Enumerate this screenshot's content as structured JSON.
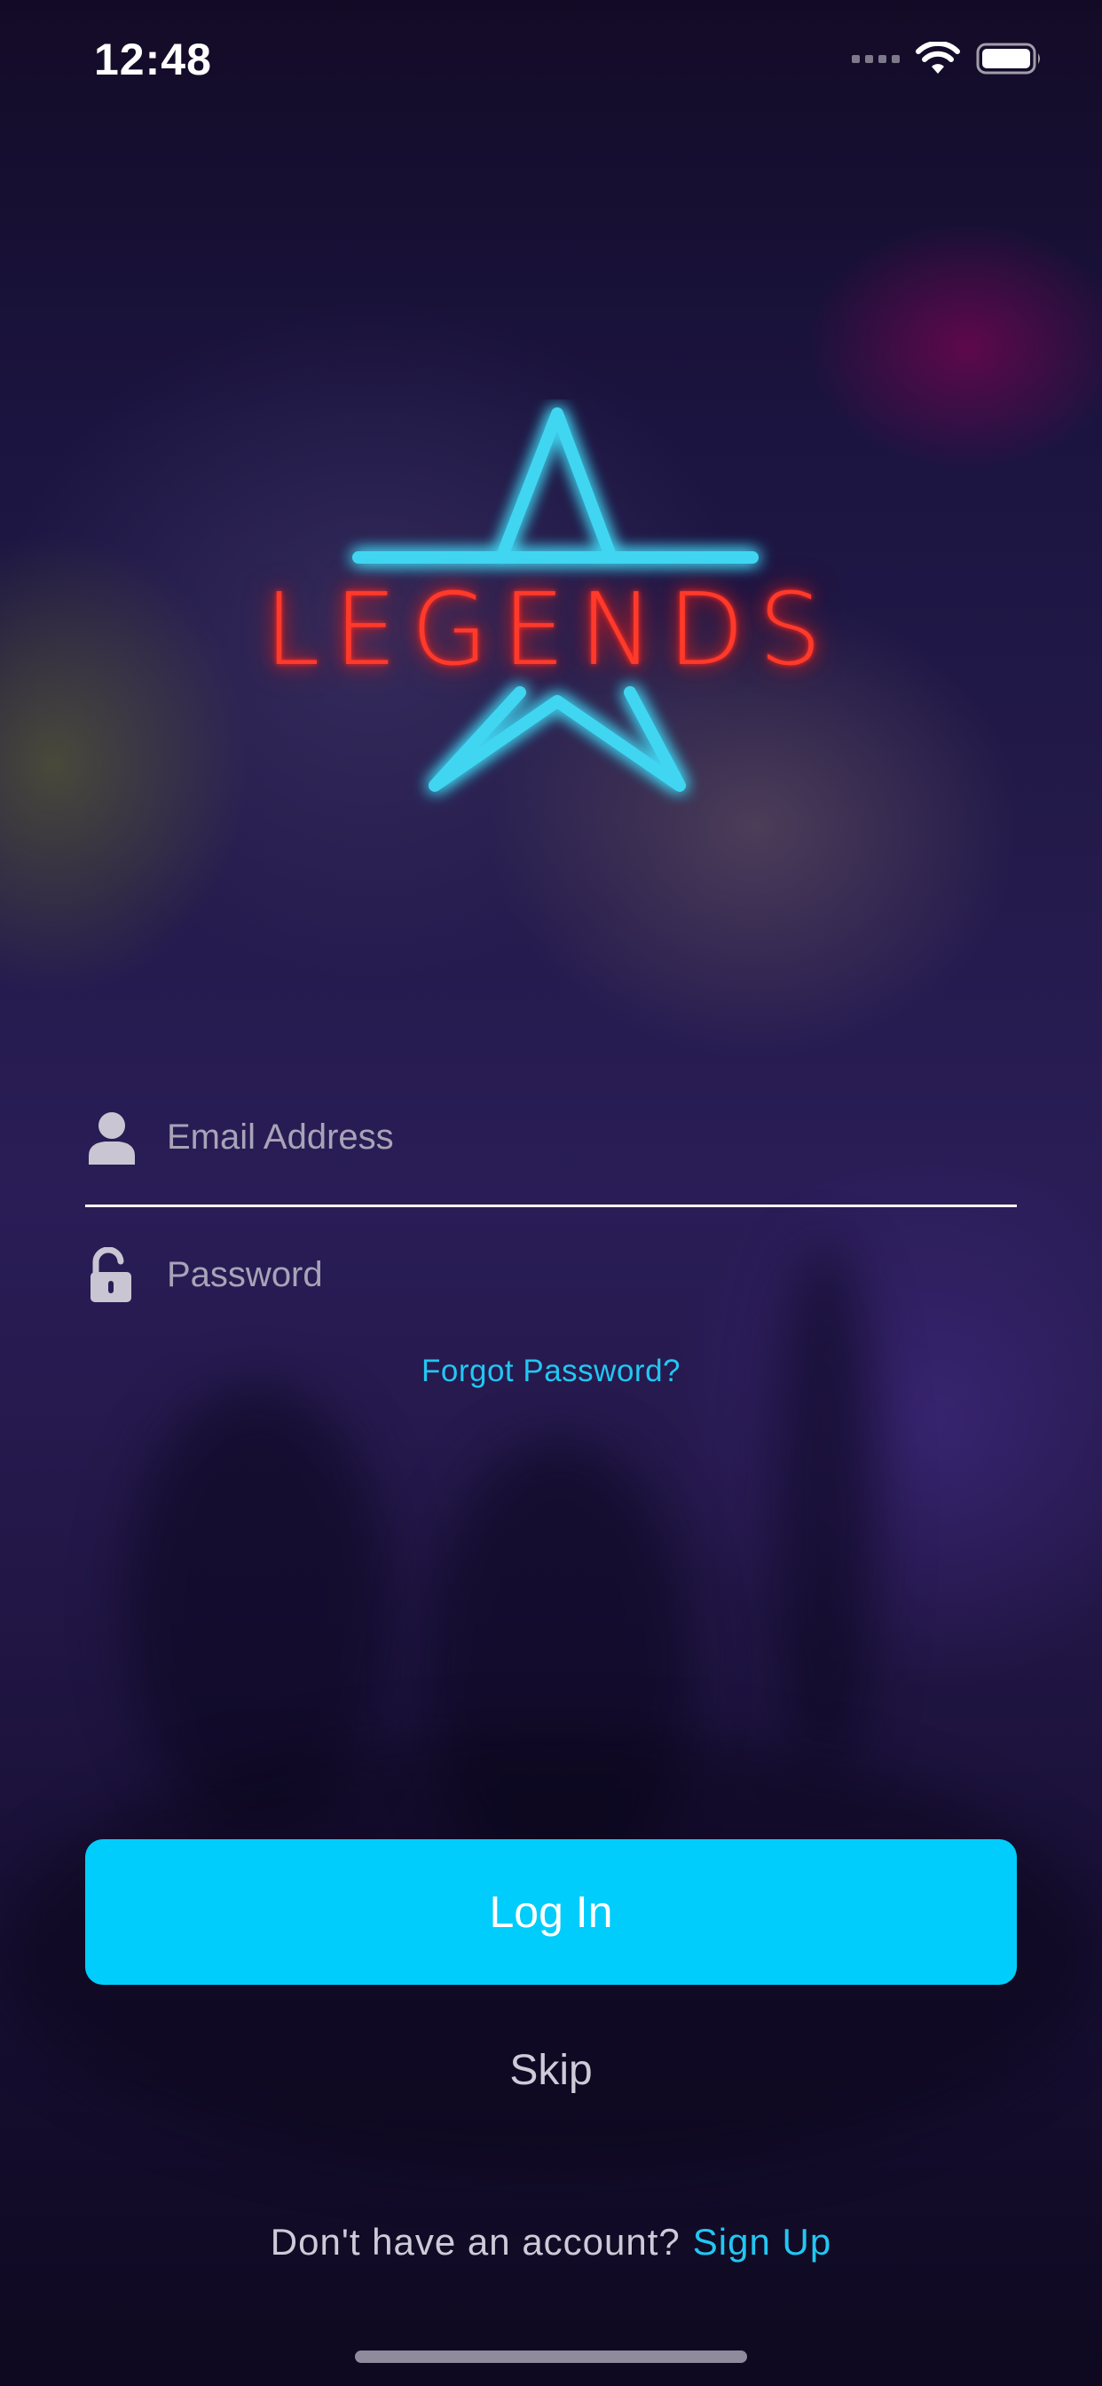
{
  "status_bar": {
    "time": "12:48",
    "icons": [
      "cellular-signal-icon",
      "wifi-icon",
      "battery-icon"
    ]
  },
  "logo": {
    "text": "LEGENDS",
    "star_color": "#3fd6f2",
    "text_color": "#ff3a2a"
  },
  "form": {
    "email_placeholder": "Email Address",
    "email_value": "",
    "password_placeholder": "Password",
    "password_value": "",
    "forgot_password": "Forgot Password?"
  },
  "actions": {
    "login_label": "Log In",
    "skip_label": "Skip",
    "signup_prompt": "Don't have an account?",
    "signup_link": "Sign Up"
  },
  "colors": {
    "accent": "#00cdfb",
    "link": "#22c7f2"
  }
}
